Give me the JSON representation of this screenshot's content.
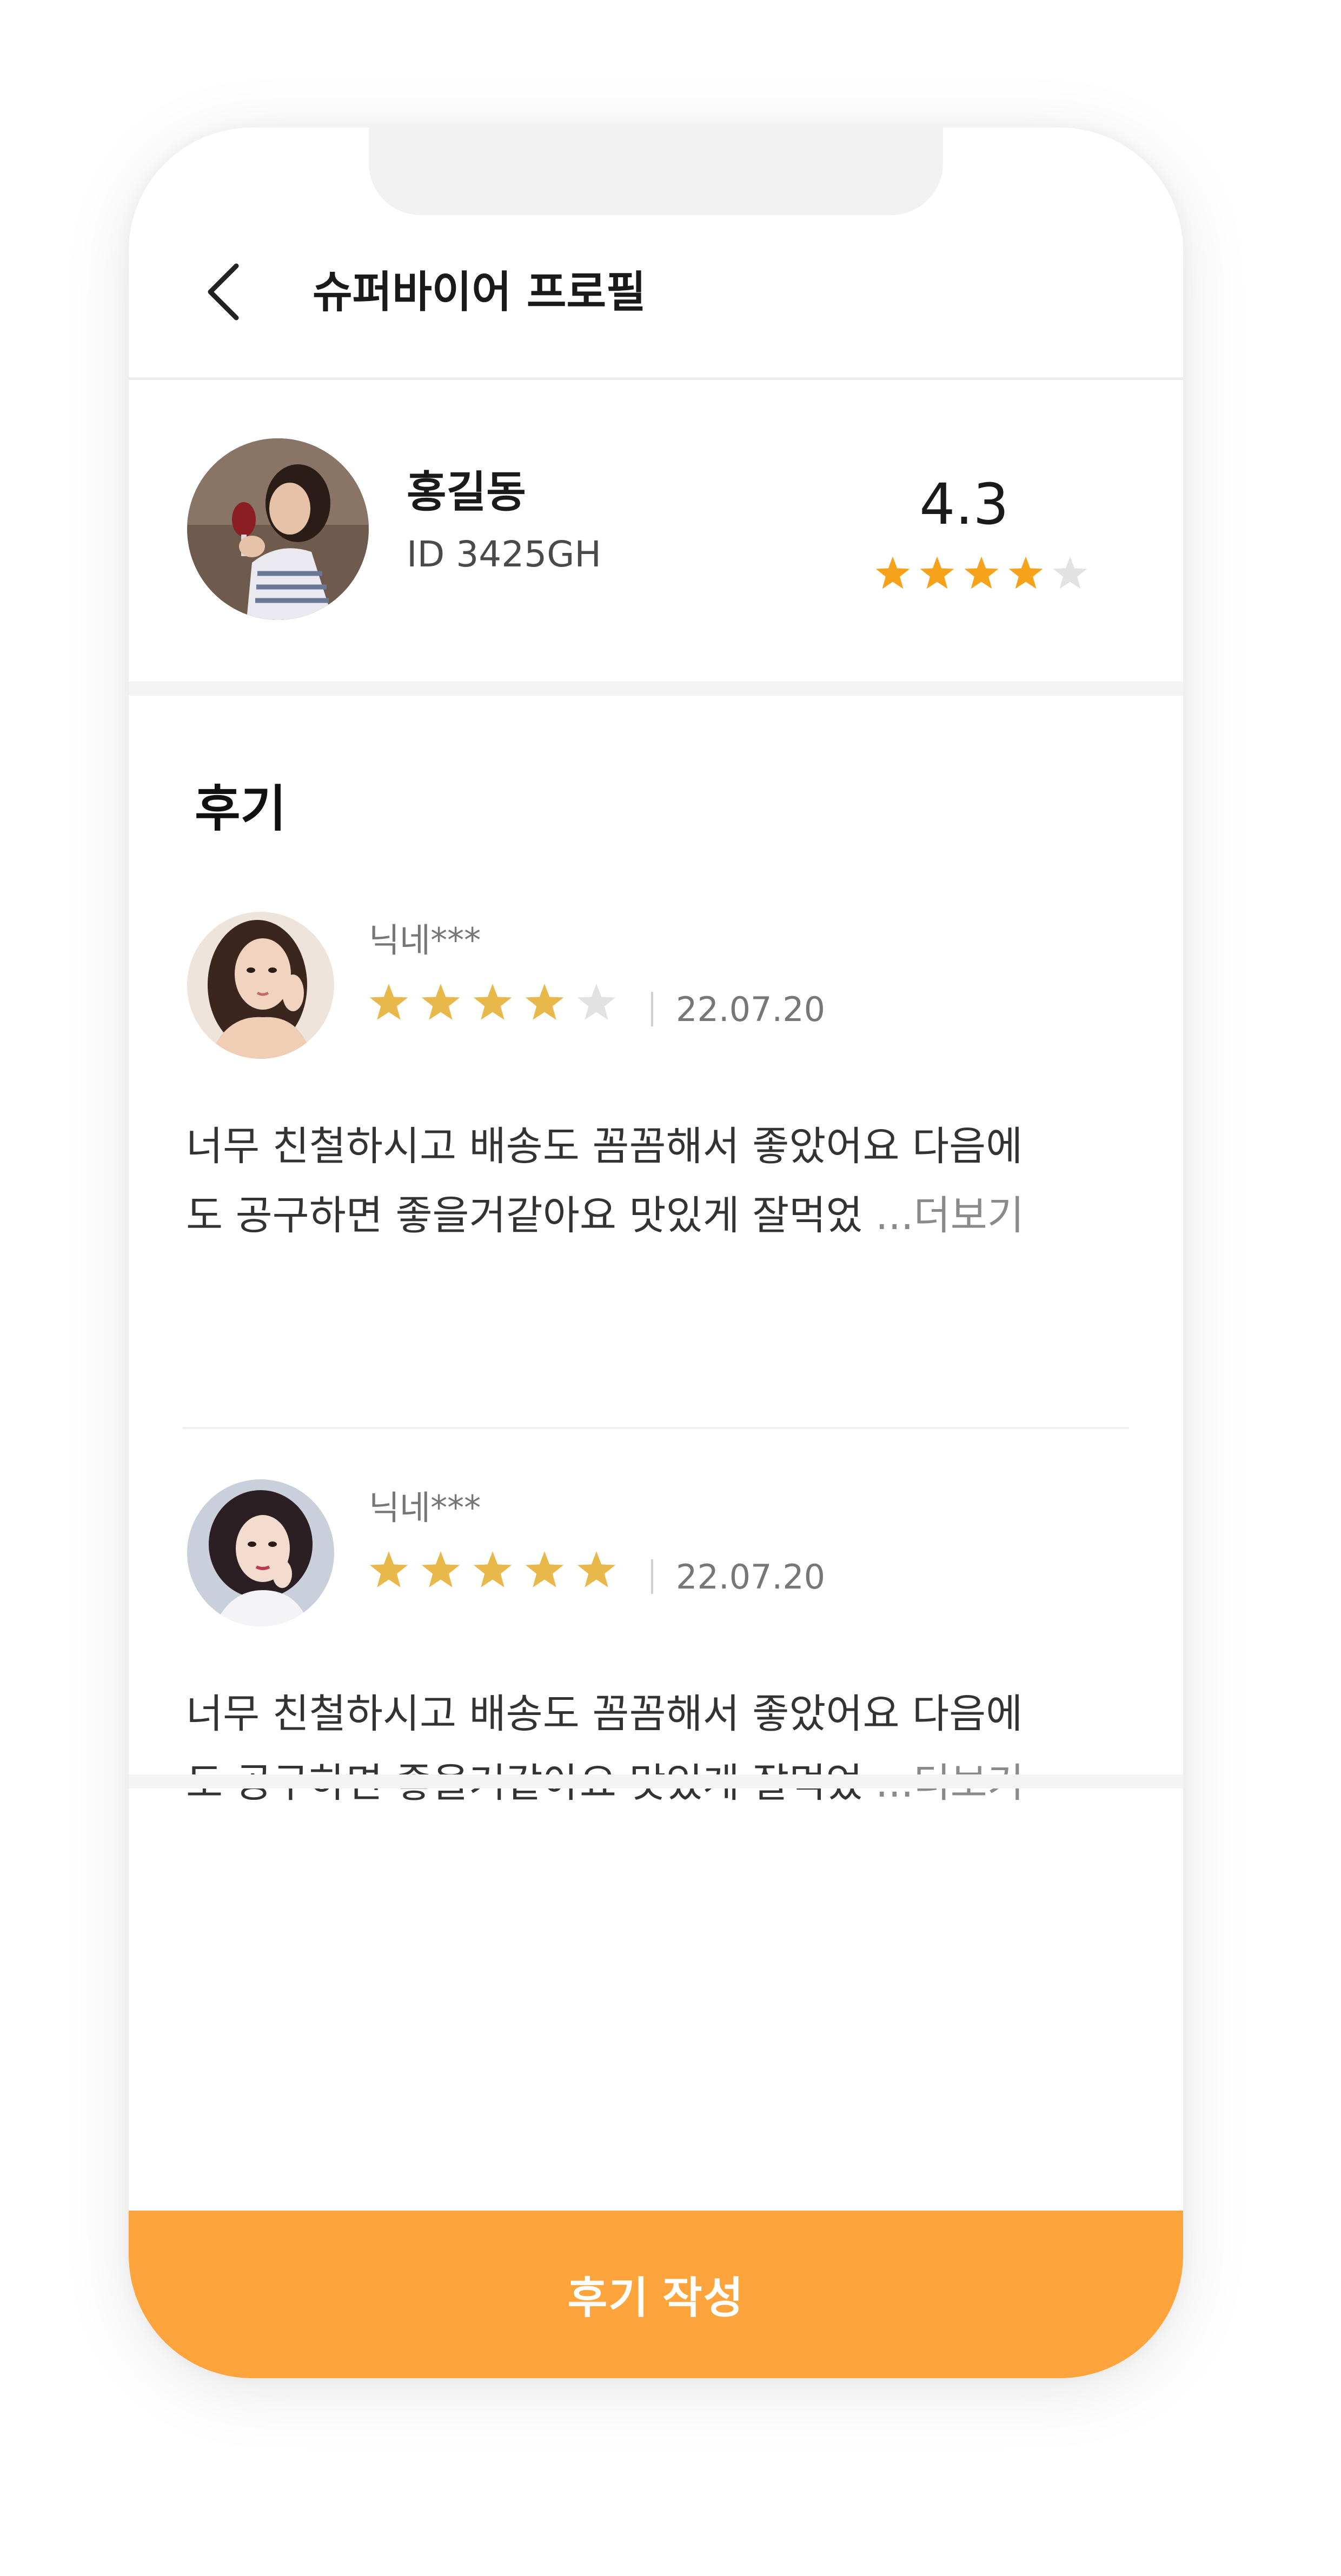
{
  "header": {
    "title": "슈퍼바이어 프로필",
    "back_icon": "chevron-left-icon"
  },
  "profile": {
    "name": "홍길동",
    "id_text": "ID 3425GH",
    "rating": "4.3",
    "stars_filled": 4,
    "stars_total": 5,
    "star_color": "#f7a21b",
    "star_empty_color": "#e2e2e2"
  },
  "reviews": {
    "section_title": "후기",
    "items": [
      {
        "user": "닉네***",
        "stars_filled": 4,
        "stars_total": 5,
        "date": "22.07.20",
        "text_line1": "너무 친철하시고 배송도 꼼꼼해서 좋았어요 다음에",
        "text_line2": "도 공구하면 좋을거같아요 맛있게 잘먹었 ",
        "more": "...더보기"
      },
      {
        "user": "닉네***",
        "stars_filled": 5,
        "stars_total": 5,
        "date": "22.07.20",
        "text_line1": "너무 친철하시고 배송도 꼼꼼해서 좋았어요 다음에",
        "text_line2": "도 공구하면 좋을거같아요 맛있게 잘먹었 ",
        "more": "...더보기"
      }
    ],
    "star_color": "#e8b84a",
    "star_empty_color": "#e2e2e2"
  },
  "footer": {
    "write_label": "후기 작성",
    "button_color": "#fea43c"
  }
}
